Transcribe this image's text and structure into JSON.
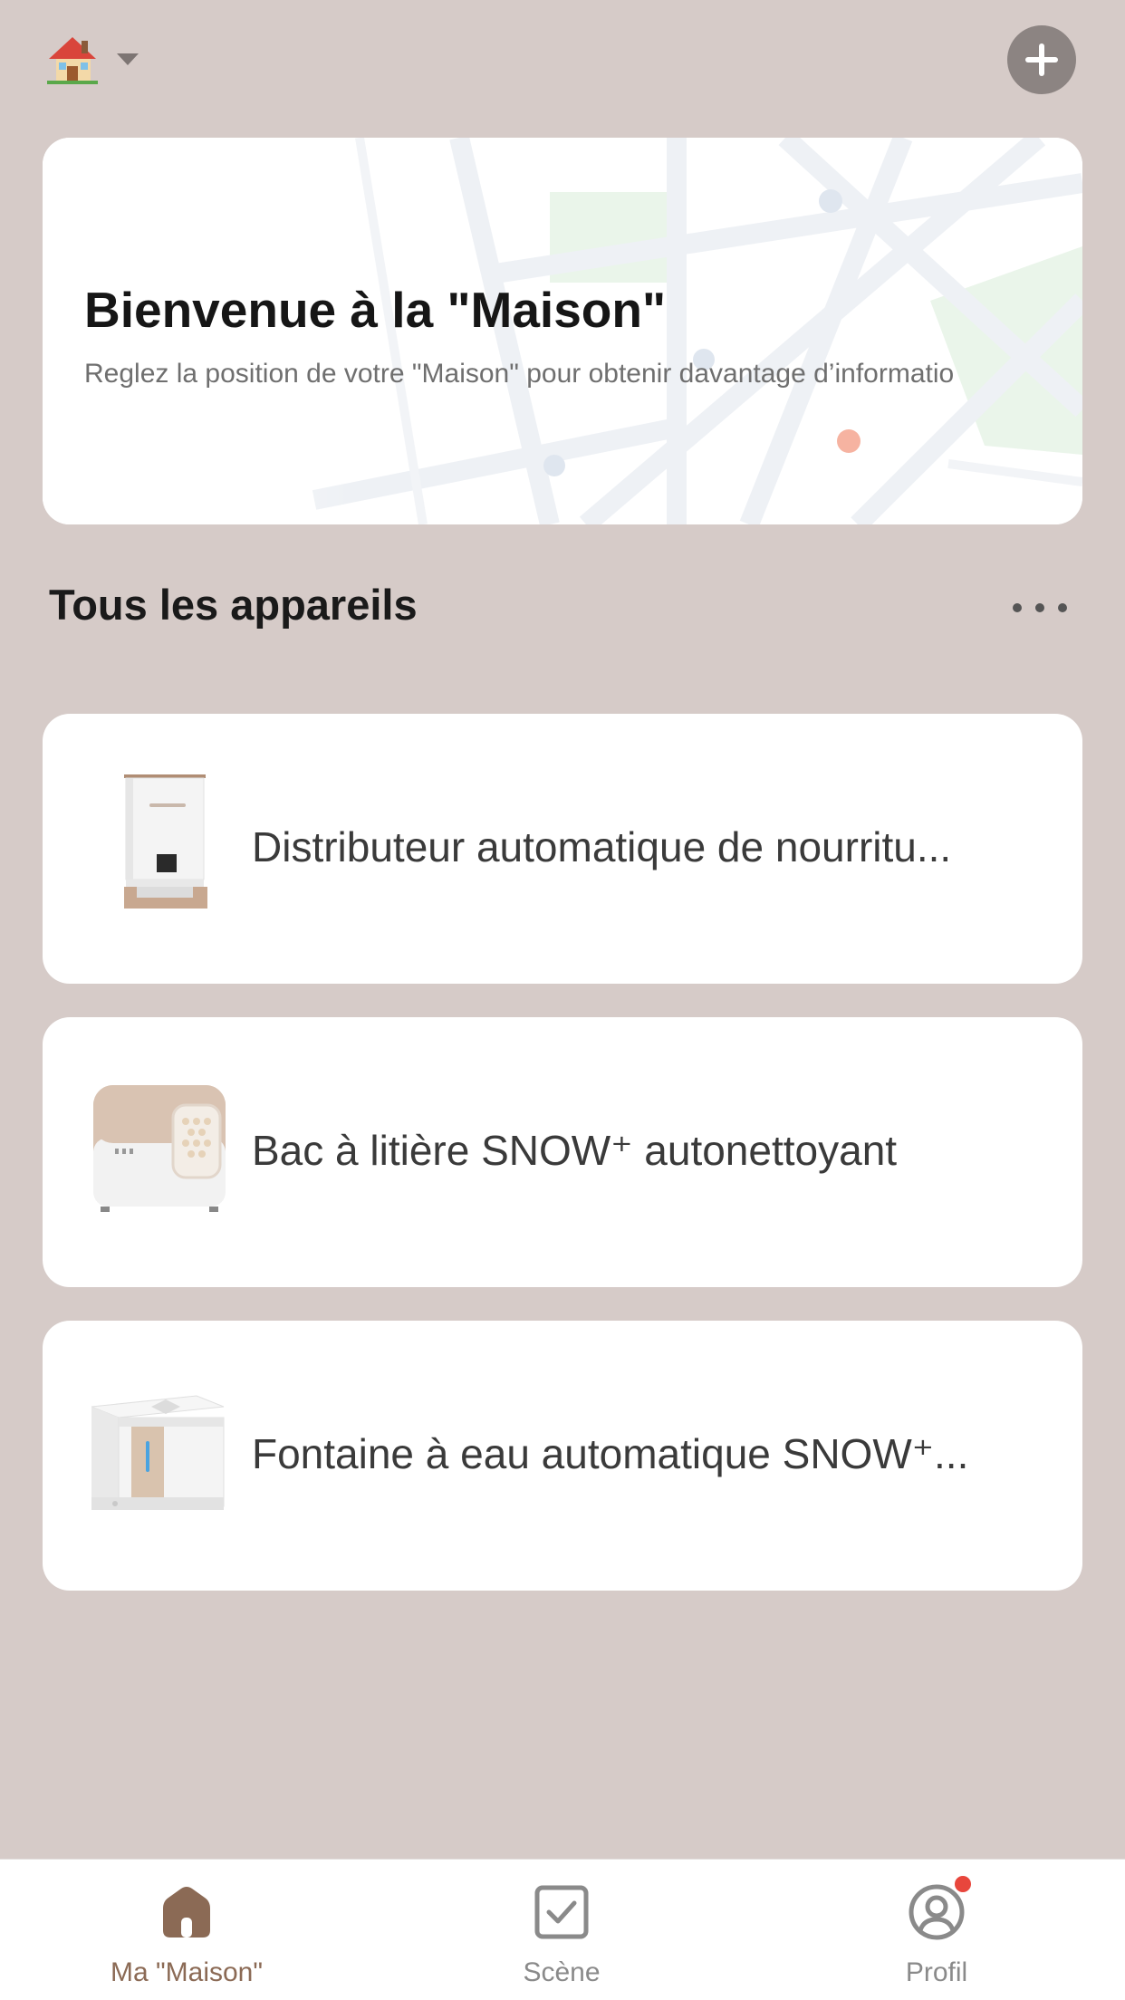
{
  "header": {
    "home_icon": "house-icon",
    "dropdown_icon": "chevron-down-icon",
    "add_icon": "plus-icon"
  },
  "welcome": {
    "title": "Bienvenue à la \"Maison\"",
    "subtitle": "Reglez la position de votre \"Maison\" pour obtenir davantage d’informatio"
  },
  "devices_section": {
    "title": "Tous les appareils",
    "more_icon": "more-horizontal-icon"
  },
  "devices": [
    {
      "name": "Distributeur automatique de nourritu...",
      "icon": "food-dispenser-image"
    },
    {
      "name": "Bac à litière SNOW⁺ autonettoyant",
      "icon": "litter-box-image"
    },
    {
      "name": "Fontaine à eau automatique SNOW⁺...",
      "icon": "water-fountain-image"
    }
  ],
  "tabbar": {
    "tabs": [
      {
        "label": "Ma \"Maison\"",
        "icon": "home-icon",
        "active": true
      },
      {
        "label": "Scène",
        "icon": "scene-checkbox-icon",
        "active": false
      },
      {
        "label": "Profil",
        "icon": "profile-icon",
        "active": false,
        "notification": true
      }
    ]
  },
  "colors": {
    "background": "#d6cbc8",
    "card": "#ffffff",
    "accent": "#8b6a55",
    "add_button": "#8c8482",
    "badge": "#e8463c"
  }
}
